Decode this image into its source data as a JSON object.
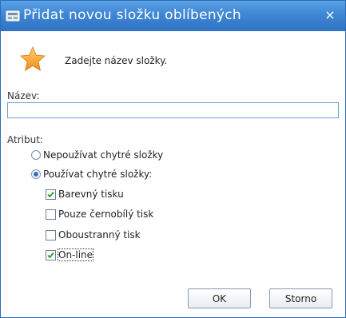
{
  "window": {
    "title": "Přidat novou složku oblíbených",
    "close_symbol": "×",
    "icon": "window-app-icon"
  },
  "header": {
    "icon": "star-icon",
    "instruction": "Zadejte název složky."
  },
  "name": {
    "label": "Název:",
    "value": "",
    "placeholder": ""
  },
  "attributes": {
    "label": "Atribut:",
    "radio_options": [
      {
        "label": "Nepoužívat chytré složky",
        "selected": false
      },
      {
        "label": "Používat chytré složky:",
        "selected": true
      }
    ],
    "checkboxes": [
      {
        "label": "Barevný tisku",
        "checked": true
      },
      {
        "label": "Pouze černobílý tisk",
        "checked": false
      },
      {
        "label": "Oboustranný tisk",
        "checked": false
      },
      {
        "label": "On-line",
        "checked": true
      }
    ]
  },
  "buttons": {
    "ok": "OK",
    "cancel": "Storno"
  },
  "colors": {
    "titlebar": "#3f86d4",
    "accent_check": "#2a9a2a",
    "star": "#f5a623"
  }
}
